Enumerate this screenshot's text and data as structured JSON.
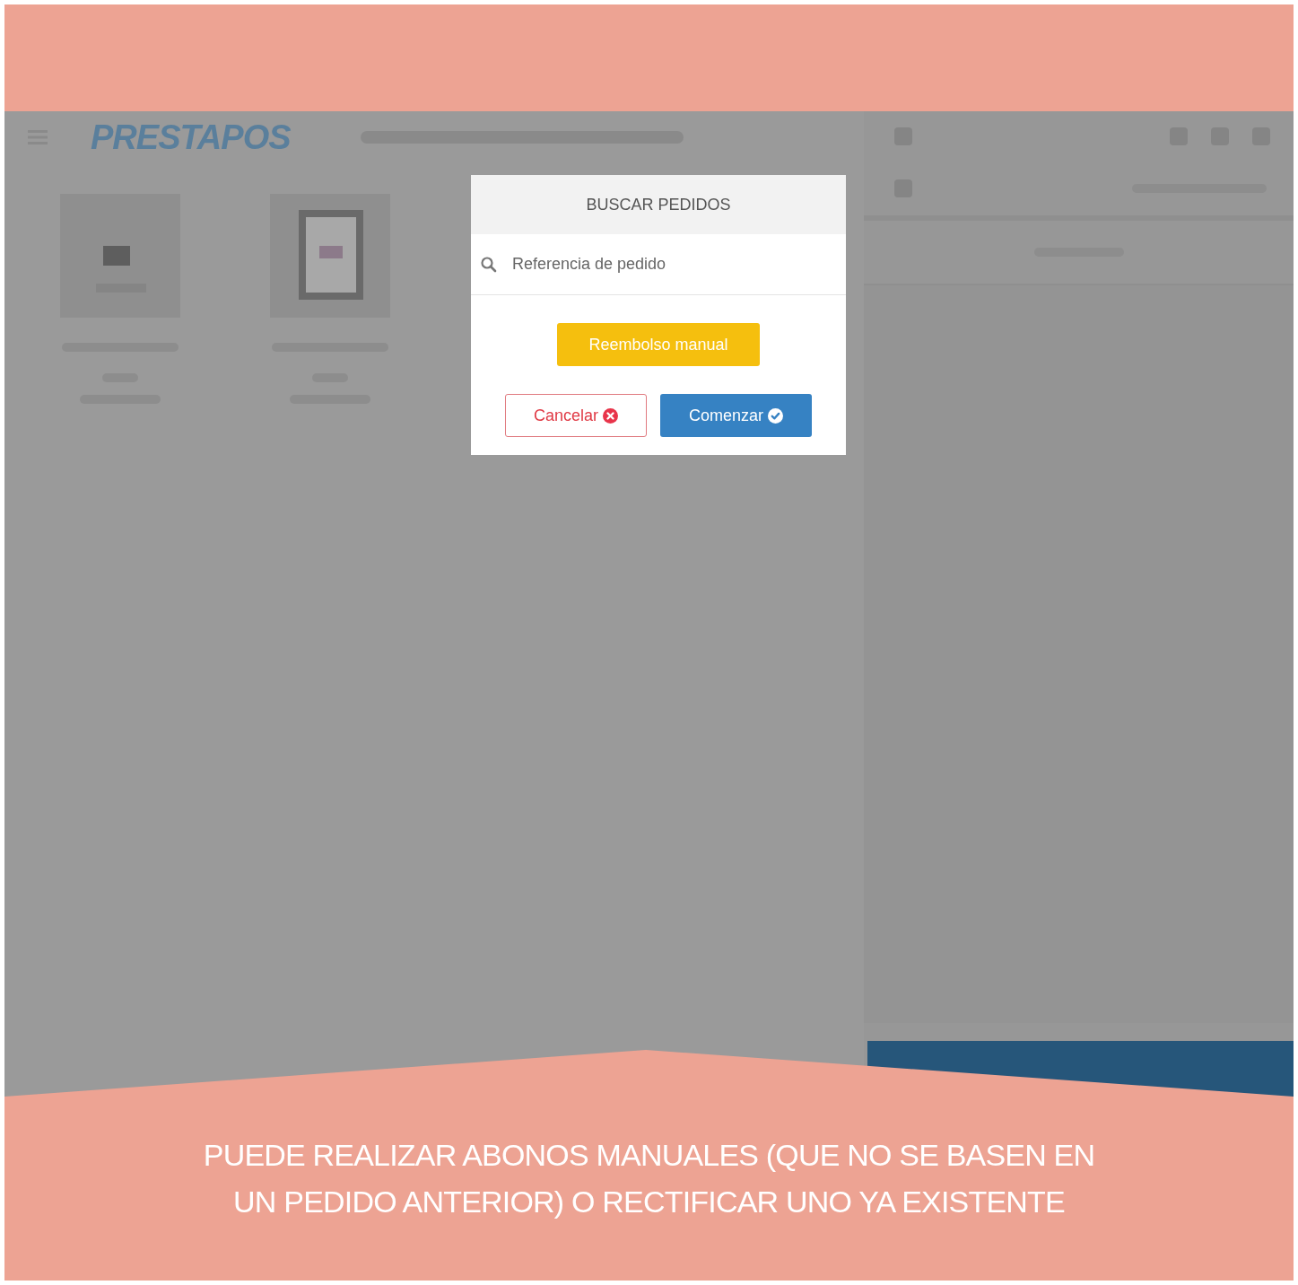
{
  "app": {
    "logo": "PRESTAPOS"
  },
  "dialog": {
    "title": "BUSCAR PEDIDOS",
    "search": {
      "placeholder": "Referencia de pedido"
    },
    "buttons": [
      {
        "label": "Reembolso manual",
        "kind": "warning"
      },
      {
        "label": "Cancelar",
        "kind": "cancel"
      },
      {
        "label": "Comenzar",
        "kind": "confirm"
      }
    ]
  },
  "caption": [
    "PUEDE REALIZAR ABONOS MANUALES (QUE NO SE BASEN EN",
    "UN PEDIDO ANTERIOR) O RECTIFICAR UNO YA EXISTENTE"
  ]
}
